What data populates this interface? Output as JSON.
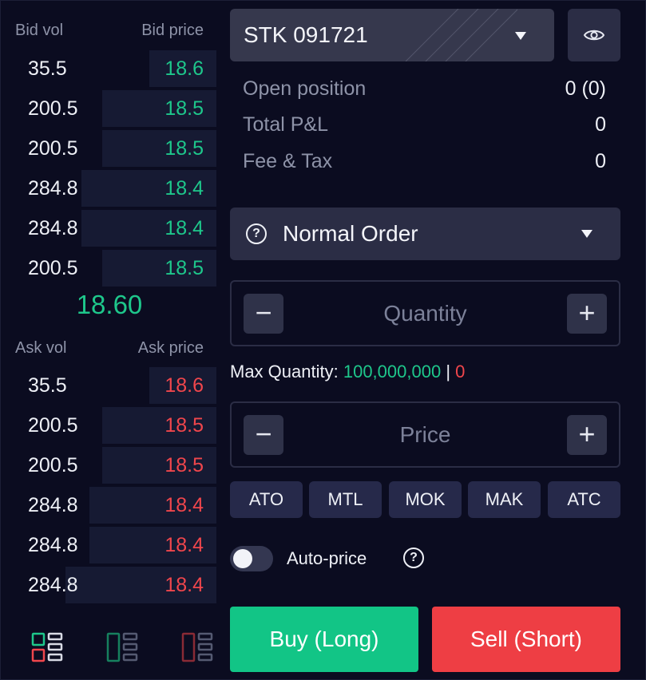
{
  "order_book": {
    "bid": {
      "vol_header": "Bid vol",
      "price_header": "Bid price",
      "rows": [
        {
          "vol": "35.5",
          "price": "18.6",
          "depth": 0.33
        },
        {
          "vol": "200.5",
          "price": "18.5",
          "depth": 0.56
        },
        {
          "vol": "200.5",
          "price": "18.5",
          "depth": 0.56
        },
        {
          "vol": "284.8",
          "price": "18.4",
          "depth": 0.66
        },
        {
          "vol": "284.8",
          "price": "18.4",
          "depth": 0.66
        },
        {
          "vol": "200.5",
          "price": "18.5",
          "depth": 0.56
        }
      ]
    },
    "last_price": "18.60",
    "ask": {
      "vol_header": "Ask vol",
      "price_header": "Ask price",
      "rows": [
        {
          "vol": "35.5",
          "price": "18.6",
          "depth": 0.33
        },
        {
          "vol": "200.5",
          "price": "18.5",
          "depth": 0.56
        },
        {
          "vol": "200.5",
          "price": "18.5",
          "depth": 0.56
        },
        {
          "vol": "284.8",
          "price": "18.4",
          "depth": 0.62
        },
        {
          "vol": "284.8",
          "price": "18.4",
          "depth": 0.62
        },
        {
          "vol": "284.8",
          "price": "18.4",
          "depth": 0.74
        }
      ]
    },
    "layout_icons": [
      "layout-both-icon",
      "layout-bid-only-icon",
      "layout-ask-only-icon"
    ]
  },
  "symbol": {
    "value": "STK 091721",
    "dropdown_icon": "caret-down-icon",
    "watch_icon": "eye-icon"
  },
  "position": {
    "open_label": "Open position",
    "open_value": "0 (0)",
    "pnl_label": "Total P&L",
    "pnl_value": "0",
    "fee_label": "Fee & Tax",
    "fee_value": "0"
  },
  "order_type": {
    "help_icon": "?",
    "label": "Normal Order"
  },
  "quantity": {
    "placeholder": "Quantity",
    "minus": "−",
    "plus": "+"
  },
  "max_quantity": {
    "label": "Max Quantity:",
    "long_value": "100,000,000",
    "separator": "|",
    "short_value": "0"
  },
  "price": {
    "placeholder": "Price",
    "minus": "−",
    "plus": "+"
  },
  "quick_prices": [
    "ATO",
    "MTL",
    "MOK",
    "MAK",
    "ATC"
  ],
  "auto_price": {
    "label": "Auto-price",
    "enabled": false,
    "help_icon": "?"
  },
  "actions": {
    "buy": "Buy (Long)",
    "sell": "Sell (Short)"
  },
  "colors": {
    "background": "#0b0c20",
    "bid": "#1ec78b",
    "ask": "#f0464c",
    "buy_button": "#12c586",
    "sell_button": "#ee3e44"
  }
}
